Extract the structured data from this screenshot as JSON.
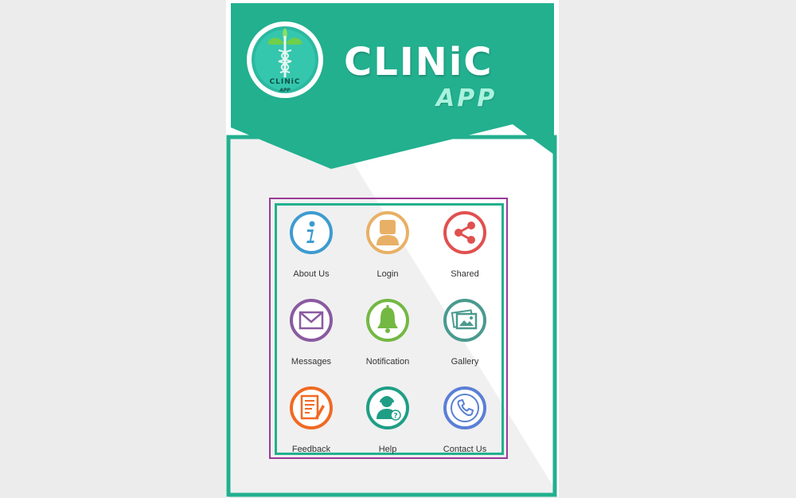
{
  "app": {
    "title": "CLINiC",
    "subtitle": "APP",
    "logo_text": "CLINiC",
    "logo_sub": "APP",
    "colors": {
      "brand": "#22b08f",
      "accent": "#a9f2dd",
      "frame": "#9a3a97"
    }
  },
  "menu": {
    "items": [
      {
        "label": "About Us",
        "icon": "info-icon",
        "color": "#3d9bd0"
      },
      {
        "label": "Login",
        "icon": "user-icon",
        "color": "#e8b066"
      },
      {
        "label": "Shared",
        "icon": "share-icon",
        "color": "#e0504f"
      },
      {
        "label": "Messages",
        "icon": "envelope-icon",
        "color": "#8a5aa0"
      },
      {
        "label": "Notification",
        "icon": "bell-icon",
        "color": "#73b843"
      },
      {
        "label": "Gallery",
        "icon": "gallery-icon",
        "color": "#4a9a8e"
      },
      {
        "label": "Feedback",
        "icon": "feedback-form-icon",
        "color": "#f06a24"
      },
      {
        "label": "Help",
        "icon": "help-support-icon",
        "color": "#1f9e85"
      },
      {
        "label": "Contact Us",
        "icon": "phone-icon",
        "color": "#5b7fd6"
      }
    ]
  }
}
